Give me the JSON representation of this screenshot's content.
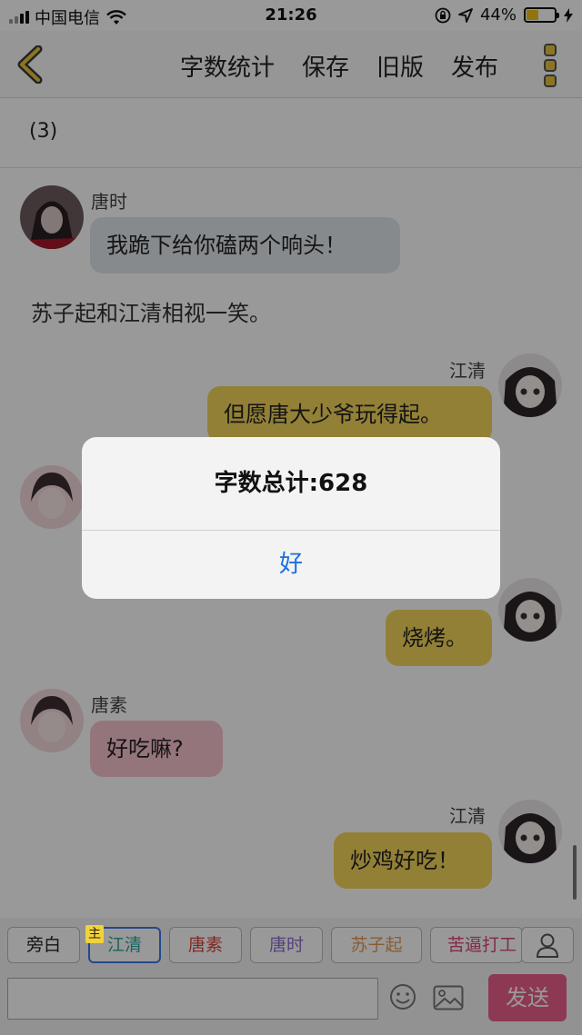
{
  "status_bar": {
    "carrier": "中国电信",
    "time": "21:26",
    "battery": "44%"
  },
  "nav": {
    "word_count": "字数统计",
    "save": "保存",
    "old_version": "旧版",
    "publish": "发布"
  },
  "chapter": "(3)",
  "messages": [
    {
      "name": "唐时",
      "text": "我跪下给你磕两个响头！"
    },
    {
      "narration": "苏子起和江清相视一笑。"
    },
    {
      "name": "江清",
      "text": "但愿唐大少爷玩得起。"
    },
    {
      "text": "烧烤。"
    },
    {
      "name": "唐素",
      "text": "好吃嘛?"
    },
    {
      "name": "江清",
      "text": "炒鸡好吃！"
    }
  ],
  "roles": [
    {
      "label": "旁白",
      "color": "#222222"
    },
    {
      "label": "江清",
      "color": "#2aa79b",
      "host_badge": "主"
    },
    {
      "label": "唐素",
      "color": "#d9453f"
    },
    {
      "label": "唐时",
      "color": "#8a6fcf"
    },
    {
      "label": "苏子起",
      "color": "#e39a57"
    },
    {
      "label": "苦逼打工",
      "color": "#d64a7a"
    }
  ],
  "send": "发送",
  "alert": {
    "title": "字数总计:628",
    "ok": "好"
  }
}
